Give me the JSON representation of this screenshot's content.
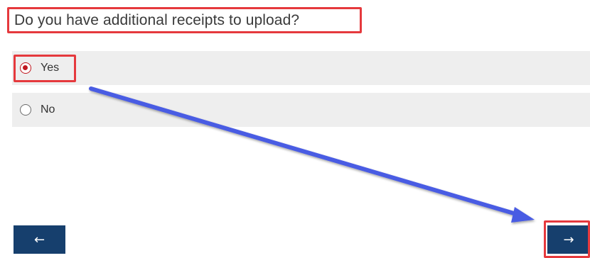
{
  "question": {
    "text": "Do you have additional receipts to upload?"
  },
  "options": [
    {
      "label": "Yes",
      "checked": true
    },
    {
      "label": "No",
      "checked": false
    }
  ],
  "navigation": {
    "back_label": "←",
    "next_label": "→"
  },
  "annotations": {
    "highlight_color": "#e5393d",
    "arrow_color": "#4a5be3",
    "radio_checked_color": "#c0171f",
    "button_color": "#163f6d"
  }
}
